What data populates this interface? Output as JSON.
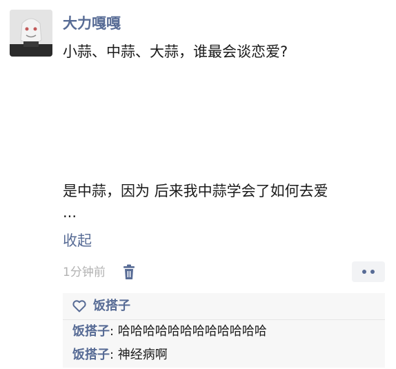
{
  "post": {
    "username": "大力嘎嘎",
    "question": "小蒜、中蒜、大蒜，谁最会谈恋爱?",
    "answer": "是中蒜，因为 后来我中蒜学会了如何去爱",
    "ellipsis": "...",
    "collapse_label": "收起",
    "time": "1分钟前"
  },
  "likes": {
    "names": "饭搭子"
  },
  "comments": [
    {
      "author": "饭搭子",
      "colon": ": ",
      "text": "哈哈哈哈哈哈哈哈哈哈哈哈"
    },
    {
      "author": "饭搭子",
      "colon": ": ",
      "text": "神经病啊"
    }
  ],
  "colors": {
    "link_blue": "#576b95",
    "text": "#1a1a1a",
    "muted": "#b2b2b2",
    "panel_bg": "#f7f7f7"
  },
  "icons": {
    "avatar": "avatar-image",
    "trash": "trash-icon",
    "more": "more-dots-icon",
    "like": "heart-icon"
  }
}
